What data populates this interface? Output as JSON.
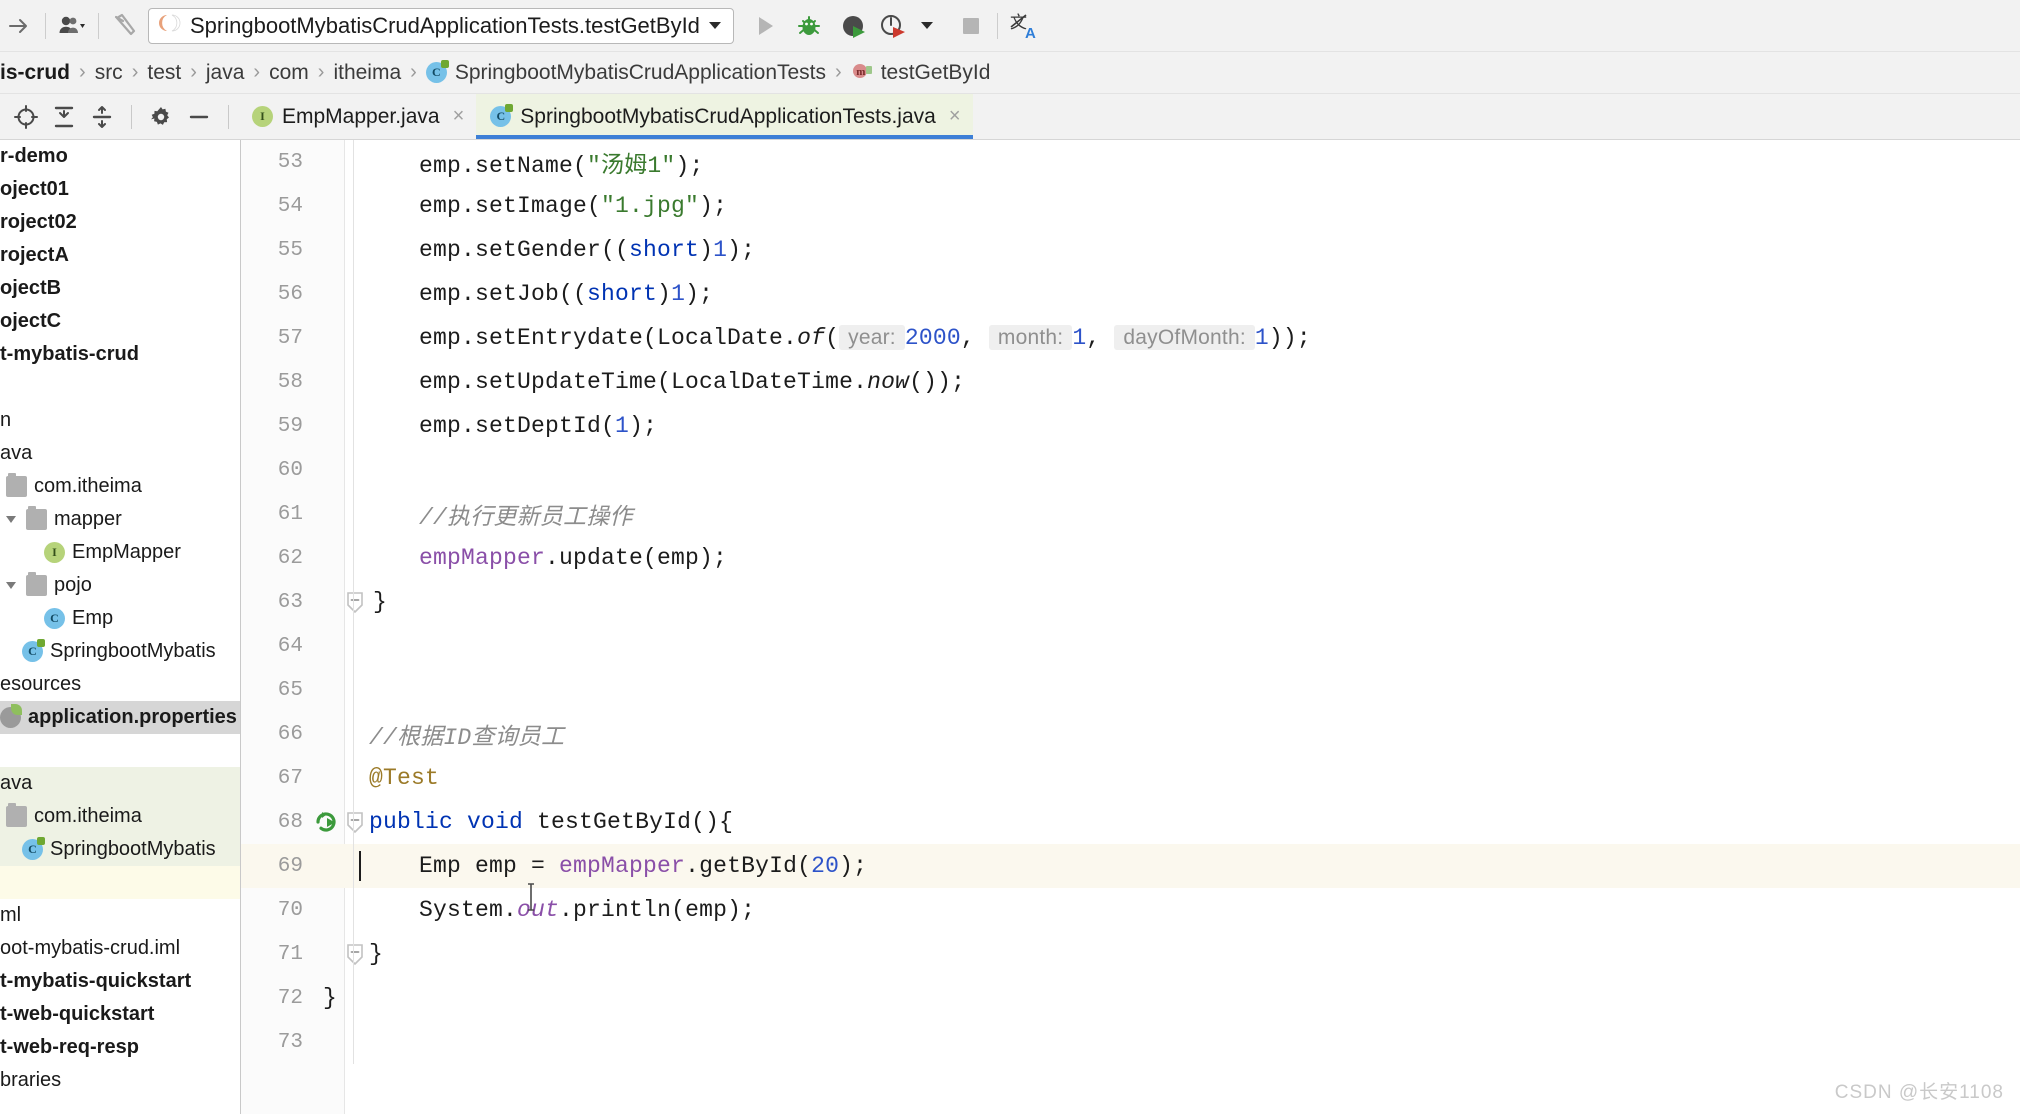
{
  "toolbar": {
    "icons": [
      {
        "name": "forward-arrow-icon",
        "glyph": "→"
      },
      {
        "name": "user-profile-icon",
        "glyph": "👤"
      },
      {
        "name": "build-hammer-icon",
        "glyph": "🔨"
      }
    ],
    "run_config": {
      "label": "SpringbootMybatisCrudApplicationTests.testGetById",
      "dropdown_caret": "▾"
    },
    "actions": [
      {
        "name": "run-button",
        "title": "Run"
      },
      {
        "name": "debug-button",
        "title": "Debug"
      },
      {
        "name": "run-with-coverage-button",
        "title": "Run with Coverage"
      },
      {
        "name": "profile-button",
        "title": "Profile"
      },
      {
        "name": "stop-button",
        "title": "Stop"
      },
      {
        "name": "translate-button",
        "title": "Translate"
      }
    ]
  },
  "breadcrumb": {
    "items": [
      {
        "label": "is-crud",
        "bold": true,
        "icon": ""
      },
      {
        "label": "src",
        "bold": false,
        "icon": ""
      },
      {
        "label": "test",
        "bold": false,
        "icon": ""
      },
      {
        "label": "java",
        "bold": false,
        "icon": ""
      },
      {
        "label": "com",
        "bold": false,
        "icon": ""
      },
      {
        "label": "itheima",
        "bold": false,
        "icon": ""
      },
      {
        "label": "SpringbootMybatisCrudApplicationTests",
        "bold": false,
        "icon": "class-icon"
      },
      {
        "label": "testGetById",
        "bold": false,
        "icon": "method-icon"
      }
    ],
    "separator": "›"
  },
  "editor_toolbar": {
    "icons": [
      {
        "name": "select-opened-file-icon"
      },
      {
        "name": "collapse-all-icon"
      },
      {
        "name": "expand-all-icon"
      },
      {
        "name": "settings-gear-icon"
      },
      {
        "name": "hide-panel-icon"
      }
    ]
  },
  "tabs": [
    {
      "label": "EmpMapper.java",
      "icon": "interface-icon",
      "active": false,
      "close": "×"
    },
    {
      "label": "SpringbootMybatisCrudApplicationTests.java",
      "icon": "spring-class-icon",
      "active": true,
      "close": "×"
    }
  ],
  "sidebar": {
    "rows": [
      {
        "label": "r-demo",
        "bold": true,
        "icon": "none",
        "indent": 0,
        "band": "none",
        "selected": false
      },
      {
        "label": "oject01",
        "bold": true,
        "icon": "none",
        "indent": 0,
        "band": "none",
        "selected": false
      },
      {
        "label": "roject02",
        "bold": true,
        "icon": "none",
        "indent": 0,
        "band": "none",
        "selected": false
      },
      {
        "label": "rojectA",
        "bold": true,
        "icon": "none",
        "indent": 0,
        "band": "none",
        "selected": false
      },
      {
        "label": "ojectB",
        "bold": true,
        "icon": "none",
        "indent": 0,
        "band": "none",
        "selected": false
      },
      {
        "label": "ojectC",
        "bold": true,
        "icon": "none",
        "indent": 0,
        "band": "none",
        "selected": false
      },
      {
        "label": "t-mybatis-crud",
        "bold": true,
        "icon": "none",
        "indent": 0,
        "band": "none",
        "selected": false
      },
      {
        "label": "",
        "bold": false,
        "icon": "none",
        "indent": 0,
        "band": "none",
        "selected": false
      },
      {
        "label": "n",
        "bold": false,
        "icon": "none",
        "indent": 0,
        "band": "none",
        "selected": false
      },
      {
        "label": "ava",
        "bold": false,
        "icon": "none",
        "indent": 0,
        "band": "none",
        "selected": false
      },
      {
        "label": "com.itheima",
        "bold": false,
        "icon": "folder",
        "indent": 6,
        "band": "none",
        "selected": false
      },
      {
        "label": "mapper",
        "bold": false,
        "icon": "folder",
        "indent": 22,
        "band": "none",
        "selected": false,
        "arrow": "open"
      },
      {
        "label": "EmpMapper",
        "bold": false,
        "icon": "iface",
        "indent": 44,
        "band": "none",
        "selected": false
      },
      {
        "label": "pojo",
        "bold": false,
        "icon": "folder",
        "indent": 22,
        "band": "none",
        "selected": false,
        "arrow": "open"
      },
      {
        "label": "Emp",
        "bold": false,
        "icon": "class",
        "indent": 44,
        "band": "none",
        "selected": false
      },
      {
        "label": "SpringbootMybatis",
        "bold": false,
        "icon": "spring",
        "indent": 22,
        "band": "none",
        "selected": false
      },
      {
        "label": "esources",
        "bold": false,
        "icon": "none",
        "indent": 0,
        "band": "none",
        "selected": false
      },
      {
        "label": "application.properties",
        "bold": true,
        "icon": "props",
        "indent": 0,
        "band": "none",
        "selected": true
      },
      {
        "label": "",
        "bold": false,
        "icon": "none",
        "indent": 0,
        "band": "none",
        "selected": false
      },
      {
        "label": "ava",
        "bold": false,
        "icon": "none",
        "indent": 0,
        "band": "green",
        "selected": false
      },
      {
        "label": "com.itheima",
        "bold": false,
        "icon": "folder",
        "indent": 6,
        "band": "green",
        "selected": false
      },
      {
        "label": "SpringbootMybatis",
        "bold": false,
        "icon": "spring",
        "indent": 22,
        "band": "green",
        "selected": false
      },
      {
        "label": "",
        "bold": false,
        "icon": "none",
        "indent": 0,
        "band": "cream",
        "selected": false
      },
      {
        "label": "ml",
        "bold": false,
        "icon": "none",
        "indent": 0,
        "band": "none",
        "selected": false
      },
      {
        "label": "oot-mybatis-crud.iml",
        "bold": false,
        "icon": "none",
        "indent": 0,
        "band": "none",
        "selected": false
      },
      {
        "label": "t-mybatis-quickstart",
        "bold": true,
        "icon": "none",
        "indent": 0,
        "band": "none",
        "selected": false
      },
      {
        "label": "t-web-quickstart",
        "bold": true,
        "icon": "none",
        "indent": 0,
        "band": "none",
        "selected": false
      },
      {
        "label": "t-web-req-resp",
        "bold": true,
        "icon": "none",
        "indent": 0,
        "band": "none",
        "selected": false
      },
      {
        "label": "braries",
        "bold": false,
        "icon": "none",
        "indent": 0,
        "band": "none",
        "selected": false
      }
    ]
  },
  "code": {
    "lines": [
      {
        "no": "53",
        "indent": 50,
        "highlight": false,
        "fold": "",
        "gutter": "",
        "tokens": [
          {
            "t": "emp.setName(",
            "c": ""
          },
          {
            "t": "\"汤姆1\"",
            "c": "t-str"
          },
          {
            "t": ");",
            "c": ""
          }
        ]
      },
      {
        "no": "54",
        "indent": 50,
        "highlight": false,
        "fold": "",
        "gutter": "",
        "tokens": [
          {
            "t": "emp.setImage(",
            "c": ""
          },
          {
            "t": "\"1.jpg\"",
            "c": "t-str"
          },
          {
            "t": ");",
            "c": ""
          }
        ]
      },
      {
        "no": "55",
        "indent": 50,
        "highlight": false,
        "fold": "",
        "gutter": "",
        "tokens": [
          {
            "t": "emp.setGender((",
            "c": ""
          },
          {
            "t": "short",
            "c": "t-kw"
          },
          {
            "t": ")",
            "c": ""
          },
          {
            "t": "1",
            "c": "t-num"
          },
          {
            "t": ");",
            "c": ""
          }
        ]
      },
      {
        "no": "56",
        "indent": 50,
        "highlight": false,
        "fold": "",
        "gutter": "",
        "tokens": [
          {
            "t": "emp.setJob((",
            "c": ""
          },
          {
            "t": "short",
            "c": "t-kw"
          },
          {
            "t": ")",
            "c": ""
          },
          {
            "t": "1",
            "c": "t-num"
          },
          {
            "t": ");",
            "c": ""
          }
        ]
      },
      {
        "no": "57",
        "indent": 50,
        "highlight": false,
        "fold": "",
        "gutter": "",
        "tokens": [
          {
            "t": "emp.setEntrydate(LocalDate.",
            "c": ""
          },
          {
            "t": "of",
            "c": "t-italic"
          },
          {
            "t": "(",
            "c": ""
          },
          {
            "t": " year: ",
            "c": "t-hint"
          },
          {
            "t": "2000",
            "c": "t-num"
          },
          {
            "t": ", ",
            "c": ""
          },
          {
            "t": " month: ",
            "c": "t-hint"
          },
          {
            "t": "1",
            "c": "t-num"
          },
          {
            "t": ", ",
            "c": ""
          },
          {
            "t": " dayOfMonth: ",
            "c": "t-hint"
          },
          {
            "t": "1",
            "c": "t-num"
          },
          {
            "t": "));",
            "c": ""
          }
        ]
      },
      {
        "no": "58",
        "indent": 50,
        "highlight": false,
        "fold": "",
        "gutter": "",
        "tokens": [
          {
            "t": "emp.setUpdateTime(LocalDateTime.",
            "c": ""
          },
          {
            "t": "now",
            "c": "t-italic"
          },
          {
            "t": "());",
            "c": ""
          }
        ]
      },
      {
        "no": "59",
        "indent": 50,
        "highlight": false,
        "fold": "",
        "gutter": "",
        "tokens": [
          {
            "t": "emp.setDeptId(",
            "c": ""
          },
          {
            "t": "1",
            "c": "t-num"
          },
          {
            "t": ");",
            "c": ""
          }
        ]
      },
      {
        "no": "60",
        "indent": 50,
        "highlight": false,
        "fold": "",
        "gutter": "",
        "tokens": []
      },
      {
        "no": "61",
        "indent": 50,
        "highlight": false,
        "fold": "",
        "gutter": "",
        "tokens": [
          {
            "t": "//执行更新员工操作",
            "c": "t-cmt"
          }
        ]
      },
      {
        "no": "62",
        "indent": 50,
        "highlight": false,
        "fold": "",
        "gutter": "",
        "tokens": [
          {
            "t": "empMapper",
            "c": "t-fld"
          },
          {
            "t": ".update(emp);",
            "c": ""
          }
        ]
      },
      {
        "no": "63",
        "indent": 4,
        "highlight": false,
        "fold": "minus",
        "gutter": "",
        "tokens": [
          {
            "t": "}",
            "c": ""
          }
        ]
      },
      {
        "no": "64",
        "indent": 4,
        "highlight": false,
        "fold": "",
        "gutter": "",
        "tokens": []
      },
      {
        "no": "65",
        "indent": 4,
        "highlight": false,
        "fold": "",
        "gutter": "",
        "tokens": []
      },
      {
        "no": "66",
        "indent": 0,
        "highlight": false,
        "fold": "",
        "gutter": "",
        "tokens": [
          {
            "t": "//根据ID查询员工",
            "c": "t-cmt"
          }
        ]
      },
      {
        "no": "67",
        "indent": 0,
        "highlight": false,
        "fold": "",
        "gutter": "",
        "tokens": [
          {
            "t": "@Test",
            "c": "t-ann"
          }
        ]
      },
      {
        "no": "68",
        "indent": 0,
        "highlight": false,
        "fold": "minus",
        "gutter": "run-test",
        "tokens": [
          {
            "t": "public",
            "c": "t-kw"
          },
          {
            "t": " ",
            "c": ""
          },
          {
            "t": "void",
            "c": "t-kw"
          },
          {
            "t": " testGetById(){",
            "c": ""
          }
        ]
      },
      {
        "no": "69",
        "indent": 50,
        "highlight": true,
        "fold": "",
        "gutter": "",
        "tokens": [
          {
            "t": "Emp emp = ",
            "c": ""
          },
          {
            "t": "empMapper",
            "c": "t-fld"
          },
          {
            "t": ".getById(",
            "c": ""
          },
          {
            "t": "20",
            "c": "t-num"
          },
          {
            "t": ");",
            "c": ""
          }
        ]
      },
      {
        "no": "70",
        "indent": 50,
        "highlight": false,
        "fold": "",
        "gutter": "",
        "tokens": [
          {
            "t": "System.",
            "c": ""
          },
          {
            "t": "out",
            "c": "t-static"
          },
          {
            "t": ".println(emp);",
            "c": ""
          }
        ]
      },
      {
        "no": "71",
        "indent": 0,
        "highlight": false,
        "fold": "minus",
        "gutter": "",
        "tokens": [
          {
            "t": "}",
            "c": ""
          }
        ]
      },
      {
        "no": "72",
        "indent": -46,
        "highlight": false,
        "fold": "",
        "gutter": "",
        "tokens": [
          {
            "t": "}",
            "c": ""
          }
        ]
      },
      {
        "no": "73",
        "indent": 0,
        "highlight": false,
        "fold": "",
        "gutter": "",
        "tokens": []
      }
    ]
  },
  "watermark": {
    "text": "CSDN @长安1108"
  },
  "colors": {
    "accent": "#3d7fd6",
    "active_tab_bg": "#eef3e2",
    "selection_bg": "#d6d6d6",
    "test_root_bg": "#eef2e4",
    "caret_line_bg": "#fbf8ee",
    "keyword": "#0033b3",
    "string": "#3a7a2e",
    "number": "#2d53c9",
    "comment": "#8c8c8c",
    "annotation": "#9b7a28",
    "field": "#8a4fa8"
  }
}
